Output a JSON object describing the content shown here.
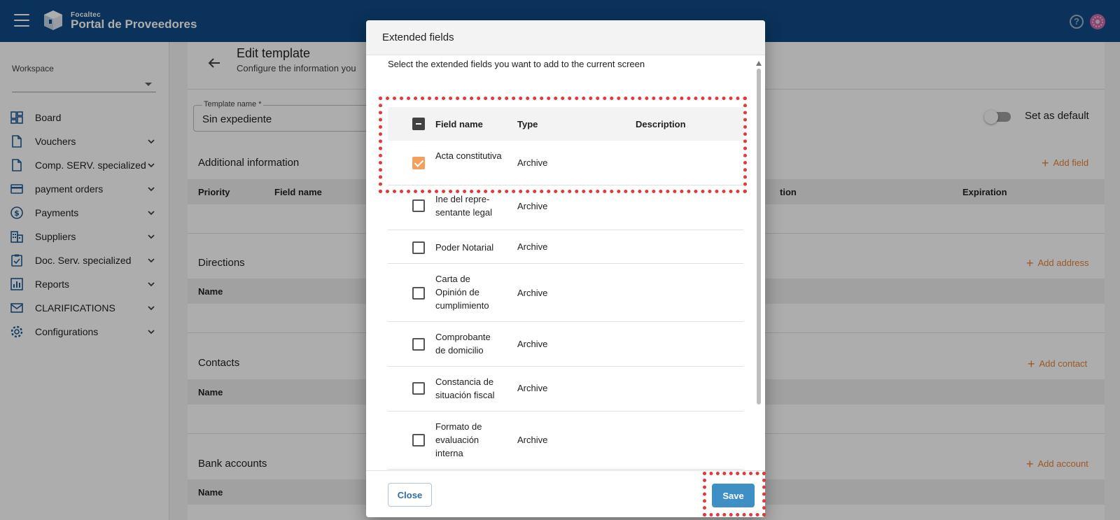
{
  "header": {
    "brand_small": "Focaltec",
    "brand_big": "Portal de Proveedores",
    "help": "?"
  },
  "sidebar": {
    "workspace_label": "Workspace",
    "workspace_value": "",
    "items": [
      {
        "label": "Board",
        "icon": "dashboard-icon",
        "expandable": false
      },
      {
        "label": "Vouchers",
        "icon": "document-icon",
        "expandable": true
      },
      {
        "label": "Comp. SERV. specialized",
        "icon": "document-icon",
        "expandable": true
      },
      {
        "label": "payment orders",
        "icon": "credit-card-icon",
        "expandable": true
      },
      {
        "label": "Payments",
        "icon": "dollar-icon",
        "expandable": true
      },
      {
        "label": "Suppliers",
        "icon": "building-icon",
        "expandable": true
      },
      {
        "label": "Doc. Serv. specialized",
        "icon": "clipboard-check-icon",
        "expandable": true
      },
      {
        "label": "Reports",
        "icon": "chart-icon",
        "expandable": true
      },
      {
        "label": "CLARIFICATIONS",
        "icon": "mail-icon",
        "expandable": true
      },
      {
        "label": "Configurations",
        "icon": "gear-icon",
        "expandable": true
      }
    ]
  },
  "page": {
    "title": "Edit template",
    "subtitle": "Configure the information you",
    "template_name_label": "Template name *",
    "template_name_value": "Sin expediente",
    "set_default_label": "Set as default",
    "sections": {
      "additional": {
        "title": "Additional information",
        "action": "Add field",
        "headers": [
          "Priority",
          "Field name",
          "tion",
          "Expiration"
        ]
      },
      "directions": {
        "title": "Directions",
        "action": "Add address",
        "headers": [
          "Name"
        ]
      },
      "contacts": {
        "title": "Contacts",
        "action": "Add contact",
        "headers": [
          "Name"
        ]
      },
      "bank": {
        "title": "Bank accounts",
        "action": "Add account",
        "headers": [
          "Name"
        ]
      }
    }
  },
  "dialog": {
    "title": "Extended fields",
    "intro": "Select the extended fields you want to add to the current screen",
    "columns": {
      "field_name": "Field name",
      "type": "Type",
      "description": "Description"
    },
    "rows": [
      {
        "name": "Acta constitutiva",
        "type": "Archive",
        "checked": true
      },
      {
        "name": "Ine del repre- sentante legal",
        "type": "Archive",
        "checked": false
      },
      {
        "name": "Poder Notarial",
        "type": "Archive",
        "checked": false
      },
      {
        "name": "Carta de Opinión de cumplimiento",
        "type": "Archive",
        "checked": false
      },
      {
        "name": "Comprobante de domicilio",
        "type": "Archive",
        "checked": false
      },
      {
        "name": "Constancia de situación fiscal",
        "type": "Archive",
        "checked": false
      },
      {
        "name": "Formato de evaluación interna",
        "type": "Archive",
        "checked": false
      }
    ],
    "close_label": "Close",
    "save_label": "Save"
  }
}
